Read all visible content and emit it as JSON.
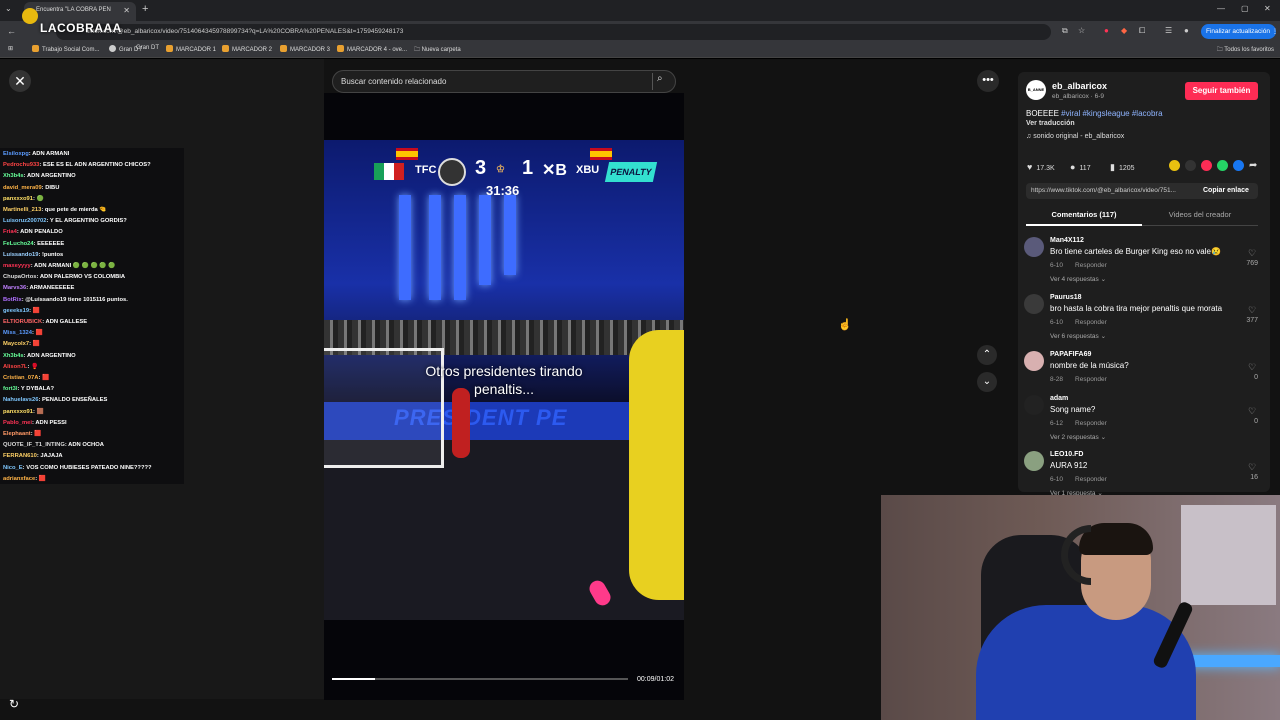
{
  "browser": {
    "tab_title": "Encuentra \"LA COBRA PEN",
    "stream_overlay_logo": "LACOBRAAA",
    "url": "tiktok.com/@eb_albaricox/video/7514064345978899734?q=LA%20COBRA%20PENALES&t=1759459248173",
    "update_button": "Finalizar actualización",
    "bookmarks": [
      "Trabajo Social Com...",
      "Gran DT",
      "MARCADOR 1",
      "MARCADOR 2",
      "MARCADOR 3",
      "MARCADOR 4 - ove...",
      "Nueva carpeta"
    ],
    "all_favorites": "Todos los favoritos"
  },
  "search": {
    "placeholder": "Buscar contenido relacionado"
  },
  "chat": [
    {
      "user": "Elsiloxpg",
      "msg": ": ADN ARMANI",
      "color": "#5b9bff"
    },
    {
      "user": "Pedrochu933",
      "msg": ": ESE ES EL ADN ARGENTINO CHICOS?",
      "color": "#ff4444"
    },
    {
      "user": "Xh3b4s",
      "msg": ": ADN ARGENTINO",
      "color": "#66ff99"
    },
    {
      "user": "david_mera09",
      "msg": ": DIBU",
      "color": "#ffb347"
    },
    {
      "user": "panxxxo91",
      "msg": ": 🟢",
      "color": "#ffe066"
    },
    {
      "user": "Martinelli_213",
      "msg": ": que pete de mierda 🤏",
      "color": "#ffd166"
    },
    {
      "user": "Luisoruz200702",
      "msg": ": Y EL ARGENTINO GORDIS?",
      "color": "#7fc8ff"
    },
    {
      "user": "Fria4",
      "msg": ": ADN PENALDO",
      "color": "#ff3355"
    },
    {
      "user": "FeLucho24",
      "msg": ": EEEEEEE",
      "color": "#66ff99"
    },
    {
      "user": "Luissando19",
      "msg": ": !puntos",
      "color": "#9ad0ff"
    },
    {
      "user": "maxeyyyy",
      "msg": ": ADN ARMANI 🟢 🟢 🟢 🟢 🟢",
      "color": "#ff3355"
    },
    {
      "user": "ChupaOrtos",
      "msg": ": ADN PALERMO VS COLOMBIA",
      "color": "#dddddd"
    },
    {
      "user": "Marvs36",
      "msg": ": ARMANEEEEEE",
      "color": "#c080ff"
    },
    {
      "user": "BotRix",
      "msg": ": @Luissando19 tiene 1015116 puntos.",
      "color": "#b070ff"
    },
    {
      "user": "geeeks19",
      "msg": ": 🟥",
      "color": "#7fc8ff"
    },
    {
      "user": "ELTIORUBICK",
      "msg": ": ADN GALLESE",
      "color": "#ff6666"
    },
    {
      "user": "Miss_1324",
      "msg": ": 🟥",
      "color": "#5b9bff"
    },
    {
      "user": "Maycolx7",
      "msg": ": 🟥",
      "color": "#ffd166"
    },
    {
      "user": "Xh3b4s",
      "msg": ": ADN ARGENTINO",
      "color": "#66ff99"
    },
    {
      "user": "Alison7L",
      "msg": ": 🥊",
      "color": "#ff4444"
    },
    {
      "user": "Cristian_07A",
      "msg": ": 🟥",
      "color": "#ffb347"
    },
    {
      "user": "fort3l",
      "msg": ": Y DYBALA?",
      "color": "#66ff99"
    },
    {
      "user": "Nahuelavs26",
      "msg": ": PENALDO ENSEÑALES",
      "color": "#7fc8ff"
    },
    {
      "user": "panxxxo91",
      "msg": ": 🟫",
      "color": "#ffe066"
    },
    {
      "user": "Pablo_mei",
      "msg": ": ADN PESSI",
      "color": "#ff3355"
    },
    {
      "user": "Elephaant",
      "msg": ": 🟥",
      "color": "#ff9966"
    },
    {
      "user": "QUOTE_IF_T1_INTING",
      "msg": ": ADN OCHOA",
      "color": "#dddddd"
    },
    {
      "user": "FERRAN610",
      "msg": ": JAJAJA",
      "color": "#ffd166"
    },
    {
      "user": "Nico_E",
      "msg": ": VOS COMO HUBIESES PATEADO NINE?????",
      "color": "#7fc8ff"
    },
    {
      "user": "adrianxface",
      "msg": ": 🟥",
      "color": "#ffb347"
    }
  ],
  "video": {
    "team_home": "TFC",
    "team_away": "XBU",
    "score_home": "3",
    "score_away": "1",
    "clock": "31:36",
    "penalty_label": "PENALTY",
    "caption_line1": "Otros presidentes tirando",
    "caption_line2": "penaltis...",
    "adboard_text": "PRESIDENT PE",
    "time": "00:09/01:02",
    "progress": 0.145
  },
  "post": {
    "avatar_text": "B_ANNE",
    "username": "eb_albaricox",
    "handle": "eb_albaricox · 6-9",
    "follow_button": "Seguir también",
    "description": "BOEEEE",
    "hashtags": "#viral #kingsleague #lacobra",
    "translate": "Ver traducción",
    "sound": "sonido original - eb_albaricox",
    "likes": "17.3K",
    "comments_count": "117",
    "saves": "1205",
    "link": "https://www.tiktok.com/@eb_albaricox/video/751...",
    "copy_link": "Copiar enlace",
    "tab_comments": "Comentarios (117)",
    "tab_videos": "Videos del creador"
  },
  "comments": [
    {
      "user": "Man4X112",
      "text": "Bro tiene carteles de Burger King eso no vale😢",
      "date": "6-10",
      "reply": "Responder",
      "more": "Ver 4 respuestas ⌄",
      "likes": "769"
    },
    {
      "user": "Paurus18",
      "text": "bro hasta la cobra tira mejor penaltis que morata",
      "date": "6-10",
      "reply": "Responder",
      "more": "Ver 6 respuestas ⌄",
      "likes": "377"
    },
    {
      "user": "PAPAFIFA69",
      "text": "nombre de la música?",
      "date": "8-28",
      "reply": "Responder",
      "more": "",
      "likes": "0"
    },
    {
      "user": "adam",
      "text": "Song name?",
      "date": "6-12",
      "reply": "Responder",
      "more": "Ver 2 respuestas ⌄",
      "likes": "0"
    },
    {
      "user": "LEO10.FD",
      "text": "AURA 912",
      "date": "6-10",
      "reply": "Responder",
      "more": "Ver 1 respuesta ⌄",
      "likes": "16"
    }
  ]
}
